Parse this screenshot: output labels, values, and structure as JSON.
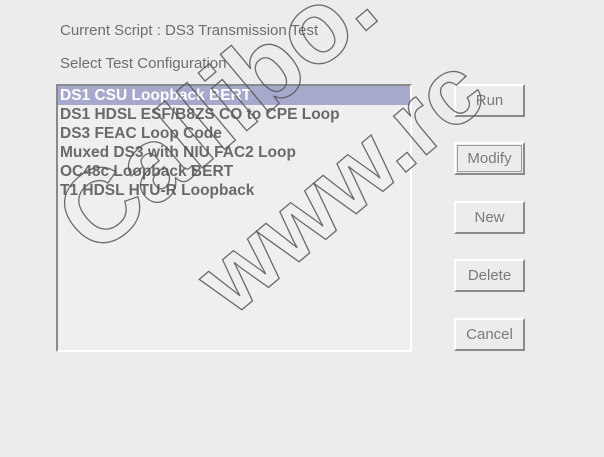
{
  "header": {
    "current_script": "Current Script : DS3 Transmission Test",
    "select_label": "Select Test Configuration"
  },
  "configurations": {
    "items": [
      {
        "label": "DS1 CSU Loopback BERT",
        "selected": true
      },
      {
        "label": "DS1 HDSL ESF/B8ZS CO to CPE Loop",
        "selected": false
      },
      {
        "label": "DS3 FEAC Loop Code",
        "selected": false
      },
      {
        "label": "Muxed DS3 with NIU FAC2 Loop",
        "selected": false
      },
      {
        "label": "OC48c Loopback BERT",
        "selected": false
      },
      {
        "label": "T1 HDSL HTU-R Loopback",
        "selected": false
      }
    ]
  },
  "buttons": {
    "run": "Run",
    "modify": "Modify",
    "new": "New",
    "delete": "Delete",
    "cancel": "Cancel"
  },
  "watermark": {
    "text_1": "Callibo.",
    "text_2": "www.rc"
  },
  "colors": {
    "background": "#ececec",
    "selection": "#a7a9cc",
    "text": "#6e6e6e"
  }
}
